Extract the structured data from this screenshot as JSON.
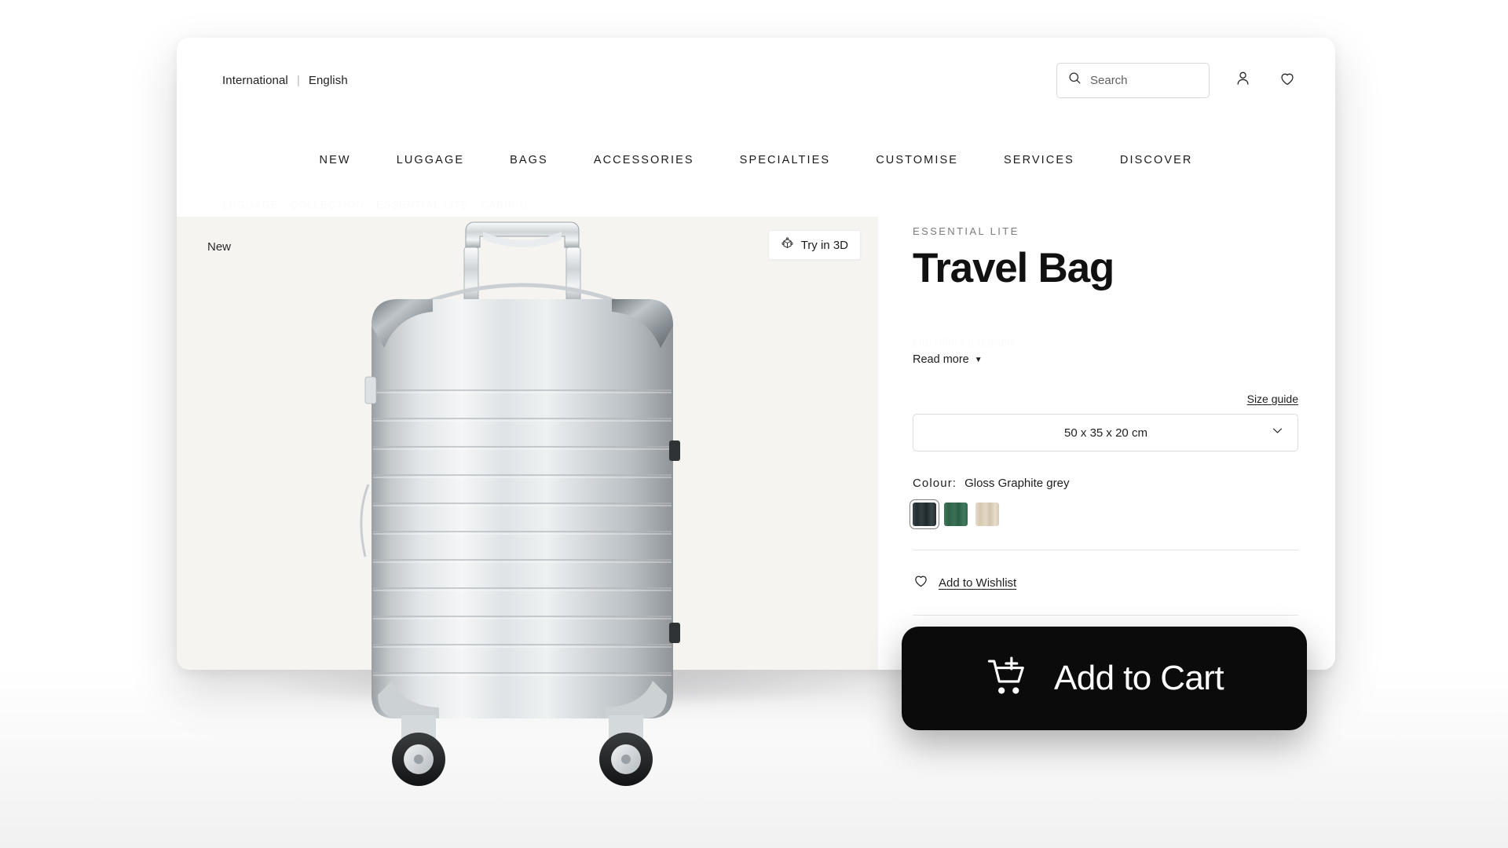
{
  "utility": {
    "region": "International",
    "divider": "|",
    "language": "English",
    "search_placeholder": "Search",
    "search_value": "",
    "account_icon": "user-icon",
    "wishlist_icon": "heart-icon",
    "search_icon": "search-icon"
  },
  "nav": {
    "items": [
      {
        "label": "NEW"
      },
      {
        "label": "LUGGAGE"
      },
      {
        "label": "BAGS"
      },
      {
        "label": "ACCESSORIES"
      },
      {
        "label": "SPECIALTIES"
      },
      {
        "label": "CUSTOMISE"
      },
      {
        "label": "SERVICES"
      },
      {
        "label": "DISCOVER"
      }
    ]
  },
  "breadcrumb": {
    "text": "LUGGAGE · COLLECTION · ESSENTIAL LITE · CABIN U"
  },
  "gallery": {
    "badge": "New",
    "try_3d_label": "Try in 3D",
    "try_3d_icon": "cube-3d-icon",
    "background_color": "#f5f4f1"
  },
  "product": {
    "collection": "ESSENTIAL LITE",
    "title": "Travel Bag",
    "description_faint": "Lite offers a durable",
    "read_more_label": "Read more",
    "read_more_icon": "chevron-down-icon"
  },
  "size": {
    "guide_label": "Size guide",
    "selected": "50 x 35 x 20 cm",
    "chevron_icon": "chevron-down-icon"
  },
  "colour": {
    "label": "Colour:",
    "selected_name": "Gloss Graphite grey",
    "swatches": [
      {
        "name": "Gloss Graphite grey",
        "hex": "#2b3538",
        "selected": true
      },
      {
        "name": "Gloss Green",
        "hex": "#366b51",
        "selected": false
      },
      {
        "name": "Gloss Sand beige",
        "hex": "#ded3bf",
        "selected": false
      }
    ]
  },
  "wishlist": {
    "label": "Add to Wishlist",
    "icon": "heart-icon"
  },
  "cart": {
    "label": "Add to Cart",
    "icon": "cart-plus-icon",
    "background": "#0b0b0b",
    "text_color": "#ffffff"
  }
}
